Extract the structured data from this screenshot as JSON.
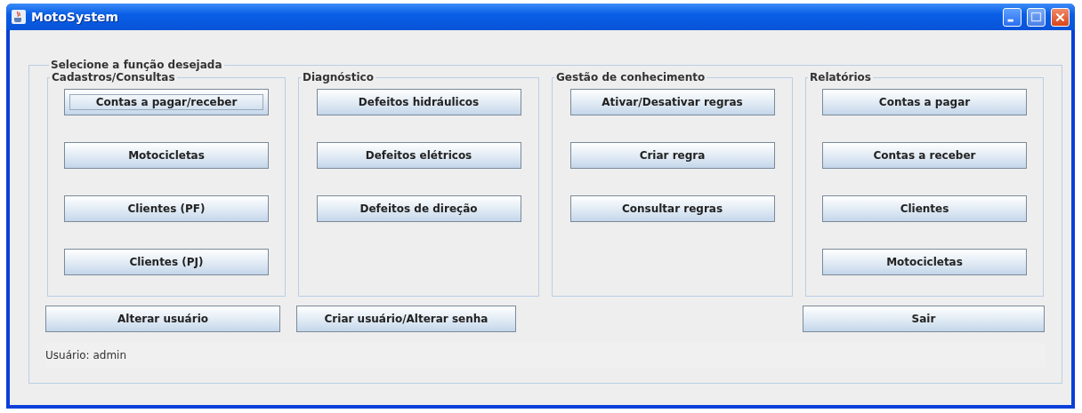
{
  "window": {
    "title": "MotoSystem"
  },
  "main_group": {
    "title": "Selecione a função desejada"
  },
  "groups": [
    {
      "title": "Cadastros/Consultas",
      "buttons": [
        {
          "label": "Contas a pagar/receber",
          "focused": true
        },
        {
          "label": "Motocicletas",
          "focused": false
        },
        {
          "label": "Clientes (PF)",
          "focused": false
        },
        {
          "label": "Clientes (PJ)",
          "focused": false
        }
      ]
    },
    {
      "title": "Diagnóstico",
      "buttons": [
        {
          "label": "Defeitos hidráulicos",
          "focused": false
        },
        {
          "label": "Defeitos elétricos",
          "focused": false
        },
        {
          "label": "Defeitos de direção",
          "focused": false
        }
      ]
    },
    {
      "title": "Gestão de conhecimento",
      "buttons": [
        {
          "label": "Ativar/Desativar regras",
          "focused": false
        },
        {
          "label": "Criar regra",
          "focused": false
        },
        {
          "label": "Consultar regras",
          "focused": false
        }
      ]
    },
    {
      "title": "Relatórios",
      "buttons": [
        {
          "label": "Contas a pagar",
          "focused": false
        },
        {
          "label": "Contas a receber",
          "focused": false
        },
        {
          "label": "Clientes",
          "focused": false
        },
        {
          "label": "Motocicletas",
          "focused": false
        }
      ]
    }
  ],
  "left_buttons": [
    {
      "label": "Alterar usuário"
    },
    {
      "label": "Criar usuário/Alterar senha"
    }
  ],
  "right_buttons": [
    {
      "label": "Sair"
    }
  ],
  "status_bar": {
    "text": "Usuário: admin"
  }
}
